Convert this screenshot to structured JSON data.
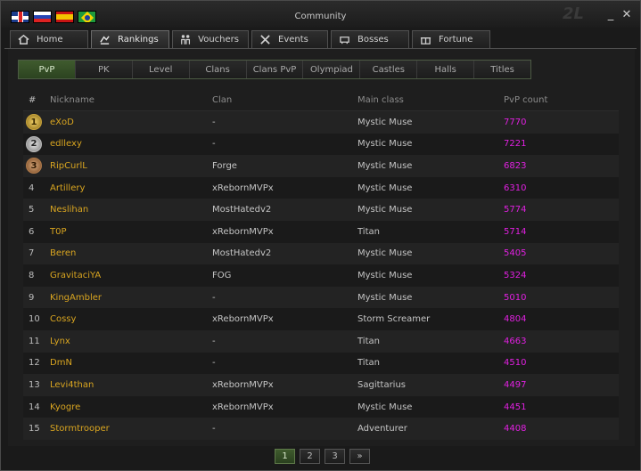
{
  "window": {
    "title": "Community",
    "close_symbol": "✕",
    "minimize_symbol": "_"
  },
  "languages": [
    "English",
    "Russian",
    "Spanish",
    "Portuguese"
  ],
  "tabs": [
    {
      "label": "Home",
      "icon": "home-icon"
    },
    {
      "label": "Rankings",
      "icon": "rankings-icon",
      "active": true
    },
    {
      "label": "Vouchers",
      "icon": "vouchers-icon"
    },
    {
      "label": "Events",
      "icon": "events-icon"
    },
    {
      "label": "Bosses",
      "icon": "bosses-icon"
    },
    {
      "label": "Fortune",
      "icon": "fortune-icon"
    }
  ],
  "subtabs": [
    "PvP",
    "PK",
    "Level",
    "Clans",
    "Clans PvP",
    "Olympiad",
    "Castles",
    "Halls",
    "Titles"
  ],
  "active_subtab": "PvP",
  "table": {
    "headers": [
      "#",
      "Nickname",
      "Clan",
      "Main class",
      "PvP count"
    ],
    "rows": [
      {
        "rank": "1",
        "nickname": "eXoD",
        "clan": "-",
        "class": "Mystic Muse",
        "pvp": "7770"
      },
      {
        "rank": "2",
        "nickname": "edllexy",
        "clan": "-",
        "class": "Mystic Muse",
        "pvp": "7221"
      },
      {
        "rank": "3",
        "nickname": "RipCurlL",
        "clan": "Forge",
        "class": "Mystic Muse",
        "pvp": "6823"
      },
      {
        "rank": "4",
        "nickname": "Artillery",
        "clan": "xRebornMVPx",
        "class": "Mystic Muse",
        "pvp": "6310"
      },
      {
        "rank": "5",
        "nickname": "Neslihan",
        "clan": "MostHatedv2",
        "class": "Mystic Muse",
        "pvp": "5774"
      },
      {
        "rank": "6",
        "nickname": "T0P",
        "clan": "xRebornMVPx",
        "class": "Titan",
        "pvp": "5714"
      },
      {
        "rank": "7",
        "nickname": "Beren",
        "clan": "MostHatedv2",
        "class": "Mystic Muse",
        "pvp": "5405"
      },
      {
        "rank": "8",
        "nickname": "GravitaciYA",
        "clan": "FOG",
        "class": "Mystic Muse",
        "pvp": "5324"
      },
      {
        "rank": "9",
        "nickname": "KingAmbler",
        "clan": "-",
        "class": "Mystic Muse",
        "pvp": "5010"
      },
      {
        "rank": "10",
        "nickname": "Cossy",
        "clan": "xRebornMVPx",
        "class": "Storm Screamer",
        "pvp": "4804"
      },
      {
        "rank": "11",
        "nickname": "Lynx",
        "clan": "-",
        "class": "Titan",
        "pvp": "4663"
      },
      {
        "rank": "12",
        "nickname": "DmN",
        "clan": "-",
        "class": "Titan",
        "pvp": "4510"
      },
      {
        "rank": "13",
        "nickname": "Levi4than",
        "clan": "xRebornMVPx",
        "class": "Sagittarius",
        "pvp": "4497"
      },
      {
        "rank": "14",
        "nickname": "Kyogre",
        "clan": "xRebornMVPx",
        "class": "Mystic Muse",
        "pvp": "4451"
      },
      {
        "rank": "15",
        "nickname": "Stormtrooper",
        "clan": "-",
        "class": "Adventurer",
        "pvp": "4408"
      }
    ]
  },
  "pagination": {
    "pages": [
      "1",
      "2",
      "3"
    ],
    "next": "»",
    "current": "1"
  },
  "colors": {
    "nickname": "#d9a520",
    "pvp_count": "#e020e0",
    "active_green": "#3f5b2e"
  }
}
